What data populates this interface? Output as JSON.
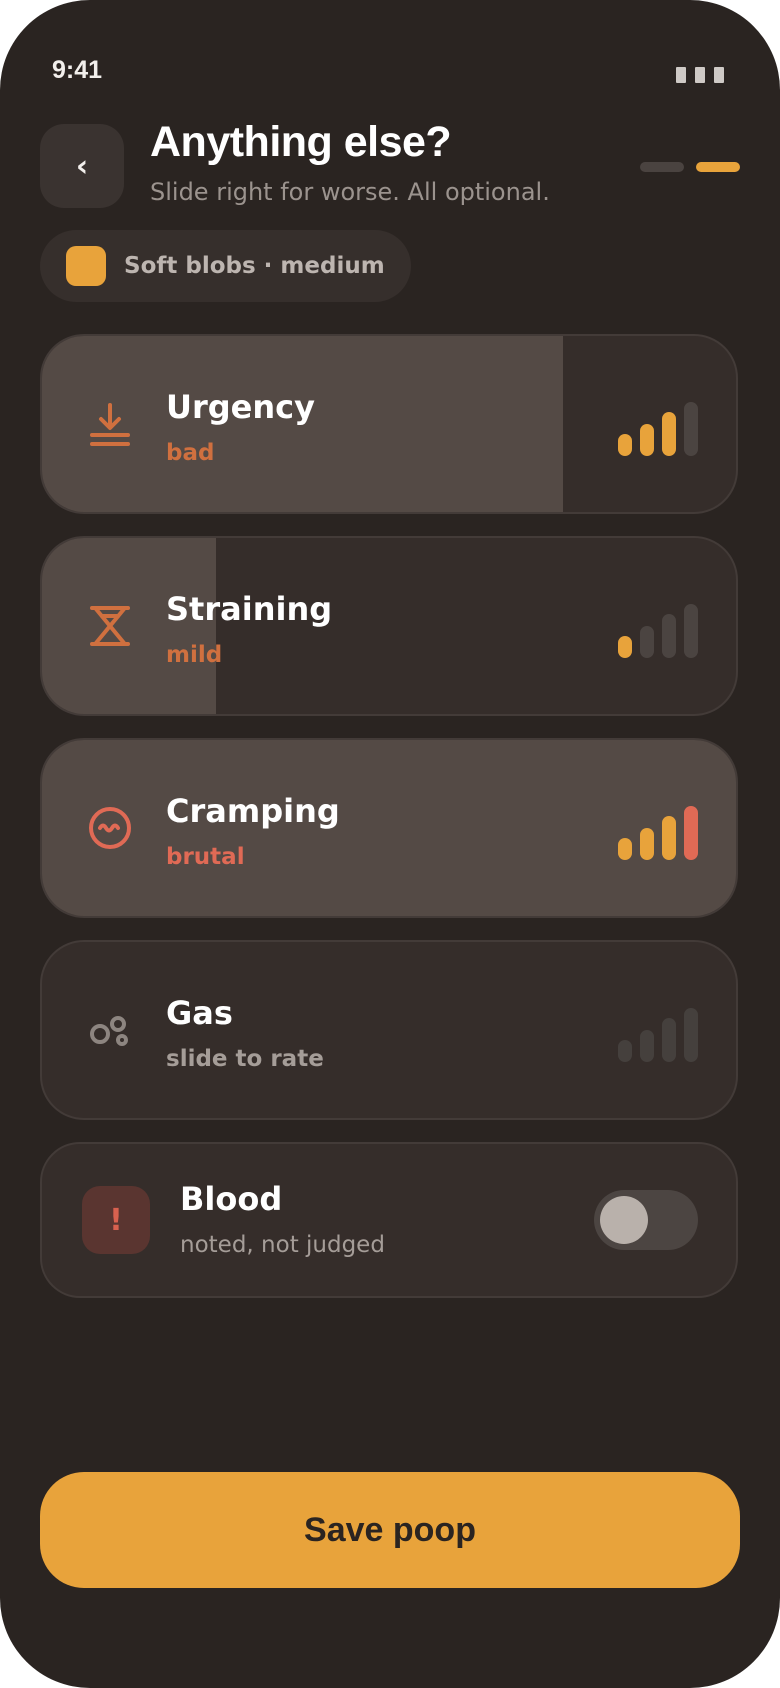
{
  "status_bar": {
    "time": "9:41"
  },
  "header": {
    "back_label": "‹",
    "title": "Anything else?",
    "subtitle": "Slide right for worse. All optional.",
    "steps_total": 2,
    "step_current": 2
  },
  "summary_chip": {
    "label": "Soft blobs · medium",
    "swatch_color": "#e8a33b"
  },
  "symptoms": [
    {
      "id": "urgency",
      "icon": "download-arrow-icon",
      "title": "Urgency",
      "value_label": "bad",
      "level": 3,
      "max_level": 4,
      "fill_fraction": 0.75,
      "value_color": "#d0703f",
      "icon_color": "#d0703f"
    },
    {
      "id": "straining",
      "icon": "hourglass-icon",
      "title": "Straining",
      "value_label": "mild",
      "level": 1,
      "max_level": 4,
      "fill_fraction": 0.25,
      "value_color": "#d0703f",
      "icon_color": "#d0703f"
    },
    {
      "id": "cramping",
      "icon": "cramp-face-icon",
      "title": "Cramping",
      "value_label": "brutal",
      "level": 4,
      "max_level": 4,
      "fill_fraction": 1.0,
      "value_color": "#e06a55",
      "icon_color": "#e06a55"
    },
    {
      "id": "gas",
      "icon": "bubbles-icon",
      "title": "Gas",
      "value_label": "slide to rate",
      "level": 0,
      "max_level": 4,
      "fill_fraction": 0,
      "value_color": "#a59d98",
      "icon_color": "#8d8580"
    }
  ],
  "blood": {
    "icon_glyph": "!",
    "title": "Blood",
    "subtitle": "noted, not judged",
    "enabled": false
  },
  "save_label": "Save poop",
  "colors": {
    "accent": "#e8a33b",
    "danger": "#e06a55",
    "meter_off": "#4b4441"
  }
}
